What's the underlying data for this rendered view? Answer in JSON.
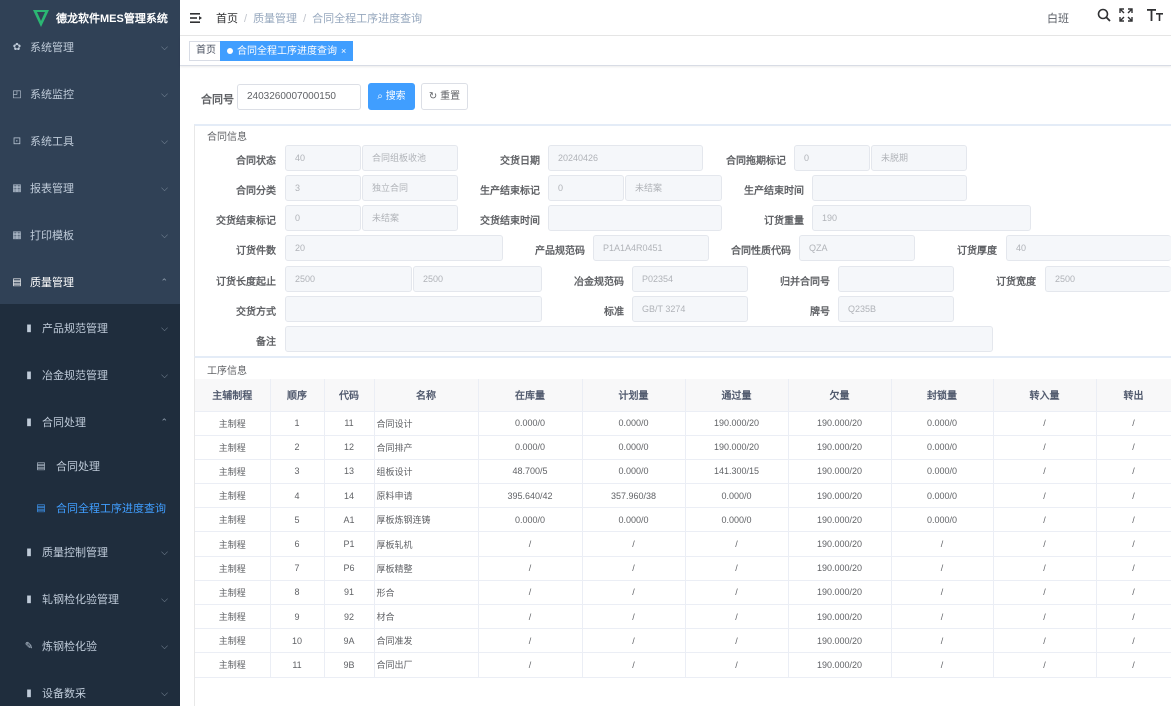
{
  "app": {
    "title": "德龙软件MES管理系统"
  },
  "sidebar": {
    "items": [
      {
        "label": "系统管理",
        "icon": "gear-icon"
      },
      {
        "label": "系统监控",
        "icon": "monitor-icon"
      },
      {
        "label": "系统工具",
        "icon": "toolbox-icon"
      },
      {
        "label": "报表管理",
        "icon": "grid-icon"
      },
      {
        "label": "打印模板",
        "icon": "grid-icon"
      },
      {
        "label": "质量管理",
        "icon": "document-icon"
      },
      {
        "label": "产品规范管理",
        "icon": "book-icon"
      },
      {
        "label": "冶金规范管理",
        "icon": "book-icon"
      },
      {
        "label": "合同处理",
        "icon": "book-icon"
      },
      {
        "label": "合同处理",
        "icon": "document-icon"
      },
      {
        "label": "合同全程工序进度查询",
        "icon": "document-icon"
      },
      {
        "label": "质量控制管理",
        "icon": "book-icon"
      },
      {
        "label": "轧钢检化验管理",
        "icon": "book-icon"
      },
      {
        "label": "炼钢检化验",
        "icon": "edit-icon"
      },
      {
        "label": "设备数采",
        "icon": "book-icon"
      }
    ]
  },
  "header": {
    "breadcrumb": [
      "首页",
      "质量管理",
      "合同全程工序进度查询"
    ],
    "user": "白班"
  },
  "tags": {
    "home": "首页",
    "current": "合同全程工序进度查询"
  },
  "search": {
    "label": "合同号",
    "value": "2403260007000150",
    "search_button": "搜索",
    "reset_button": "重置"
  },
  "contract": {
    "title": "合同信息",
    "labels": {
      "status": "合同状态",
      "delivery_date": "交货日期",
      "delay_flag": "合同拖期标记",
      "category": "合同分类",
      "prod_end_flag": "生产结束标记",
      "prod_end_time": "生产结束时间",
      "deliv_end_flag": "交货结束标记",
      "deliv_end_time": "交货结束时间",
      "order_weight": "订货重量",
      "order_pieces": "订货件数",
      "product_spec": "产品规范码",
      "property_code": "合同性质代码",
      "order_thickness": "订货厚度",
      "length_range": "订货长度起止",
      "metal_spec": "冶金规范码",
      "merge_no": "归并合同号",
      "order_width": "订货宽度",
      "delivery_method": "交货方式",
      "standard": "标准",
      "grade": "牌号",
      "remark": "备注"
    },
    "values": {
      "status_code": "40",
      "status_text": "合同组板收池",
      "delivery_date": "20240426",
      "delay_code": "0",
      "delay_text": "未脱期",
      "category_code": "3",
      "category_text": "独立合同",
      "prod_end_code": "0",
      "prod_end_text": "未结案",
      "prod_end_time": "",
      "deliv_end_code": "0",
      "deliv_end_text": "未结案",
      "deliv_end_time": "",
      "order_weight": "190",
      "order_pieces": "20",
      "product_spec": "P1A1A4R0451",
      "property_code": "QZA",
      "order_thickness": "40",
      "length_from": "2500",
      "length_to": "2500",
      "metal_spec": "P02354",
      "merge_no": "",
      "order_width": "2500",
      "delivery_method": "",
      "standard": "GB/T 3274",
      "grade": "Q235B",
      "remark": ""
    }
  },
  "process": {
    "title": "工序信息",
    "columns": [
      "主辅制程",
      "顺序",
      "代码",
      "名称",
      "在库量",
      "计划量",
      "通过量",
      "欠量",
      "封锁量",
      "转入量",
      "转出"
    ],
    "rows": [
      [
        "主制程",
        "1",
        "11",
        "合同设计",
        "0.000/0",
        "0.000/0",
        "190.000/20",
        "190.000/20",
        "0.000/0",
        "/",
        "/"
      ],
      [
        "主制程",
        "2",
        "12",
        "合同排产",
        "0.000/0",
        "0.000/0",
        "190.000/20",
        "190.000/20",
        "0.000/0",
        "/",
        "/"
      ],
      [
        "主制程",
        "3",
        "13",
        "组板设计",
        "48.700/5",
        "0.000/0",
        "141.300/15",
        "190.000/20",
        "0.000/0",
        "/",
        "/"
      ],
      [
        "主制程",
        "4",
        "14",
        "原料申请",
        "395.640/42",
        "357.960/38",
        "0.000/0",
        "190.000/20",
        "0.000/0",
        "/",
        "/"
      ],
      [
        "主制程",
        "5",
        "A1",
        "厚板炼钢连铸",
        "0.000/0",
        "0.000/0",
        "0.000/0",
        "190.000/20",
        "0.000/0",
        "/",
        "/"
      ],
      [
        "主制程",
        "6",
        "P1",
        "厚板轧机",
        "/",
        "/",
        "/",
        "190.000/20",
        "/",
        "/",
        "/"
      ],
      [
        "主制程",
        "7",
        "P6",
        "厚板精整",
        "/",
        "/",
        "/",
        "190.000/20",
        "/",
        "/",
        "/"
      ],
      [
        "主制程",
        "8",
        "91",
        "形合",
        "/",
        "/",
        "/",
        "190.000/20",
        "/",
        "/",
        "/"
      ],
      [
        "主制程",
        "9",
        "92",
        "材合",
        "/",
        "/",
        "/",
        "190.000/20",
        "/",
        "/",
        "/"
      ],
      [
        "主制程",
        "10",
        "9A",
        "合同准发",
        "/",
        "/",
        "/",
        "190.000/20",
        "/",
        "/",
        "/"
      ],
      [
        "主制程",
        "11",
        "9B",
        "合同出厂",
        "/",
        "/",
        "/",
        "190.000/20",
        "/",
        "/",
        "/"
      ]
    ]
  },
  "colors": {
    "sidebar_bg": "#304156",
    "accent": "#409eff"
  }
}
